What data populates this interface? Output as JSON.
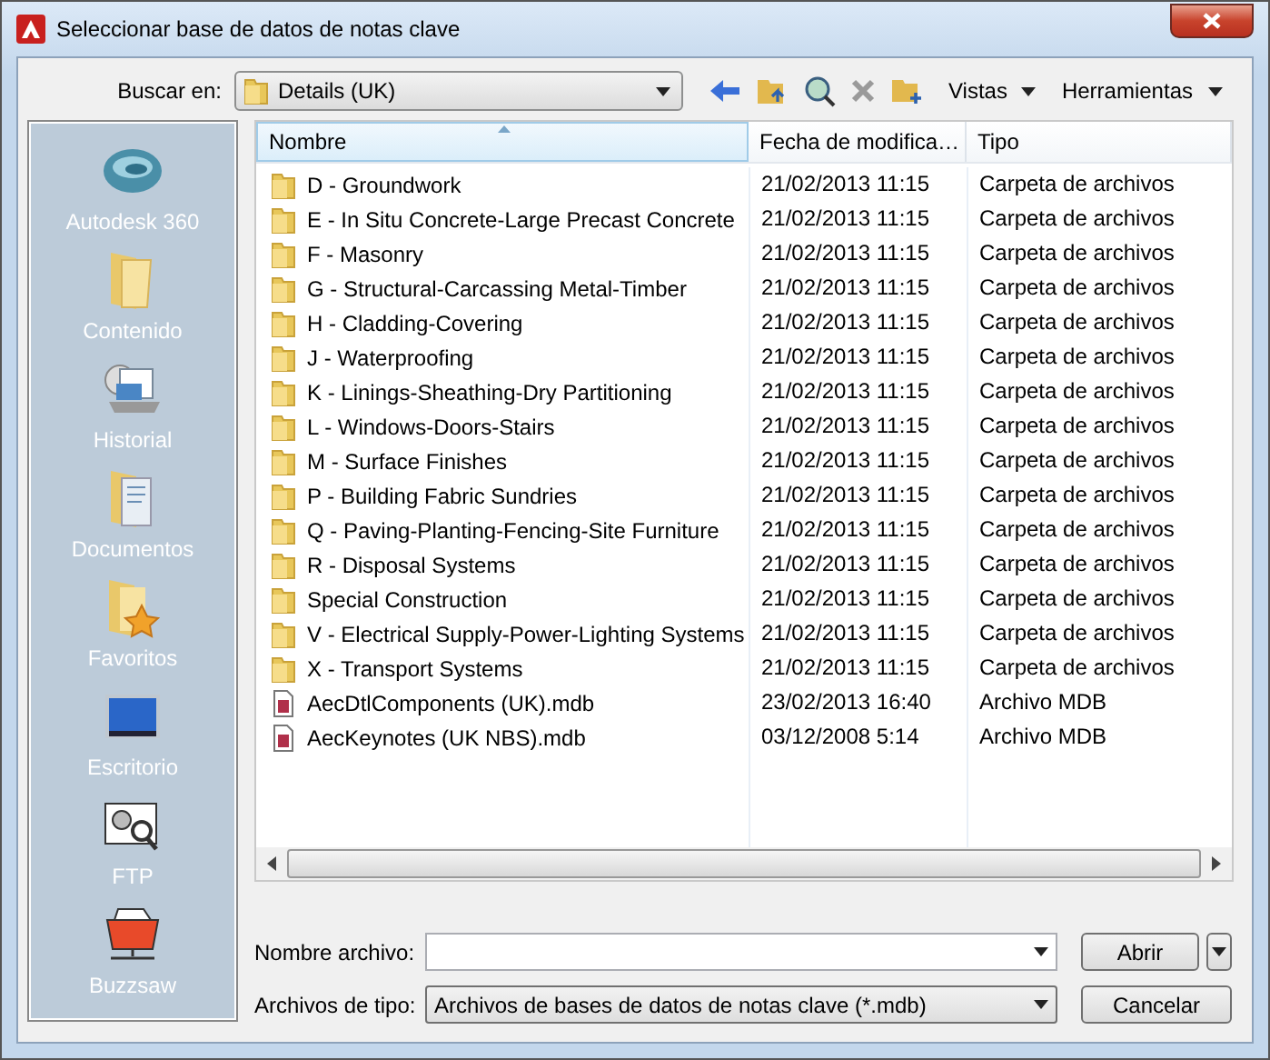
{
  "window": {
    "title": "Seleccionar base de datos de notas clave"
  },
  "toolbar": {
    "look_in_label": "Buscar en:",
    "look_in_value": "Details (UK)",
    "views": "Vistas",
    "tools": "Herramientas"
  },
  "places": [
    {
      "kind": "cloud",
      "label": "Autodesk 360"
    },
    {
      "kind": "folder",
      "label": "Contenido"
    },
    {
      "kind": "history",
      "label": "Historial"
    },
    {
      "kind": "documents",
      "label": "Documentos"
    },
    {
      "kind": "favorites",
      "label": "Favoritos"
    },
    {
      "kind": "desktop",
      "label": "Escritorio"
    },
    {
      "kind": "ftp",
      "label": "FTP"
    },
    {
      "kind": "buzzsaw",
      "label": "Buzzsaw"
    }
  ],
  "table": {
    "columns": [
      "Nombre",
      "Fecha de modifica…",
      "Tipo"
    ],
    "rows": [
      {
        "kind": "folder",
        "name": "D - Groundwork",
        "date": "21/02/2013 11:15",
        "type": "Carpeta de archivos"
      },
      {
        "kind": "folder",
        "name": "E - In Situ Concrete-Large Precast Concrete",
        "date": "21/02/2013 11:15",
        "type": "Carpeta de archivos"
      },
      {
        "kind": "folder",
        "name": "F - Masonry",
        "date": "21/02/2013 11:15",
        "type": "Carpeta de archivos"
      },
      {
        "kind": "folder",
        "name": "G - Structural-Carcassing Metal-Timber",
        "date": "21/02/2013 11:15",
        "type": "Carpeta de archivos"
      },
      {
        "kind": "folder",
        "name": "H - Cladding-Covering",
        "date": "21/02/2013 11:15",
        "type": "Carpeta de archivos"
      },
      {
        "kind": "folder",
        "name": "J - Waterproofing",
        "date": "21/02/2013 11:15",
        "type": "Carpeta de archivos"
      },
      {
        "kind": "folder",
        "name": "K - Linings-Sheathing-Dry Partitioning",
        "date": "21/02/2013 11:15",
        "type": "Carpeta de archivos"
      },
      {
        "kind": "folder",
        "name": "L - Windows-Doors-Stairs",
        "date": "21/02/2013 11:15",
        "type": "Carpeta de archivos"
      },
      {
        "kind": "folder",
        "name": "M - Surface Finishes",
        "date": "21/02/2013 11:15",
        "type": "Carpeta de archivos"
      },
      {
        "kind": "folder",
        "name": "P - Building Fabric Sundries",
        "date": "21/02/2013 11:15",
        "type": "Carpeta de archivos"
      },
      {
        "kind": "folder",
        "name": "Q - Paving-Planting-Fencing-Site Furniture",
        "date": "21/02/2013 11:15",
        "type": "Carpeta de archivos"
      },
      {
        "kind": "folder",
        "name": "R - Disposal Systems",
        "date": "21/02/2013 11:15",
        "type": "Carpeta de archivos"
      },
      {
        "kind": "folder",
        "name": "Special Construction",
        "date": "21/02/2013 11:15",
        "type": "Carpeta de archivos"
      },
      {
        "kind": "folder",
        "name": "V - Electrical Supply-Power-Lighting Systems",
        "date": "21/02/2013 11:15",
        "type": "Carpeta de archivos"
      },
      {
        "kind": "folder",
        "name": "X - Transport Systems",
        "date": "21/02/2013 11:15",
        "type": "Carpeta de archivos"
      },
      {
        "kind": "mdb",
        "name": "AecDtlComponents (UK).mdb",
        "date": "23/02/2013 16:40",
        "type": "Archivo MDB"
      },
      {
        "kind": "mdb",
        "name": "AecKeynotes (UK NBS).mdb",
        "date": "03/12/2008 5:14",
        "type": "Archivo MDB"
      }
    ]
  },
  "file_name": {
    "label": "Nombre archivo:"
  },
  "file_type": {
    "label": "Archivos de tipo:",
    "value": "Archivos de bases de datos de notas clave (*.mdb)"
  },
  "buttons": {
    "open": "Abrir",
    "cancel": "Cancelar"
  }
}
